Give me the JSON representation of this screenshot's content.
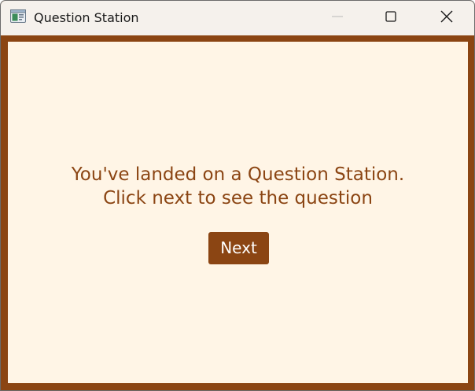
{
  "window": {
    "title": "Question Station",
    "icon": "app-window-icon",
    "controls": {
      "minimize_icon": "minimize-icon",
      "maximize_icon": "maximize-icon",
      "close_icon": "close-icon"
    }
  },
  "main": {
    "message_line1": "You've landed on a Question Station.",
    "message_line2": "Click next to see the question",
    "next_label": "Next"
  },
  "colors": {
    "accent": "#8b4513",
    "background": "#fff5e6",
    "titlebar": "#f5f1ec"
  }
}
